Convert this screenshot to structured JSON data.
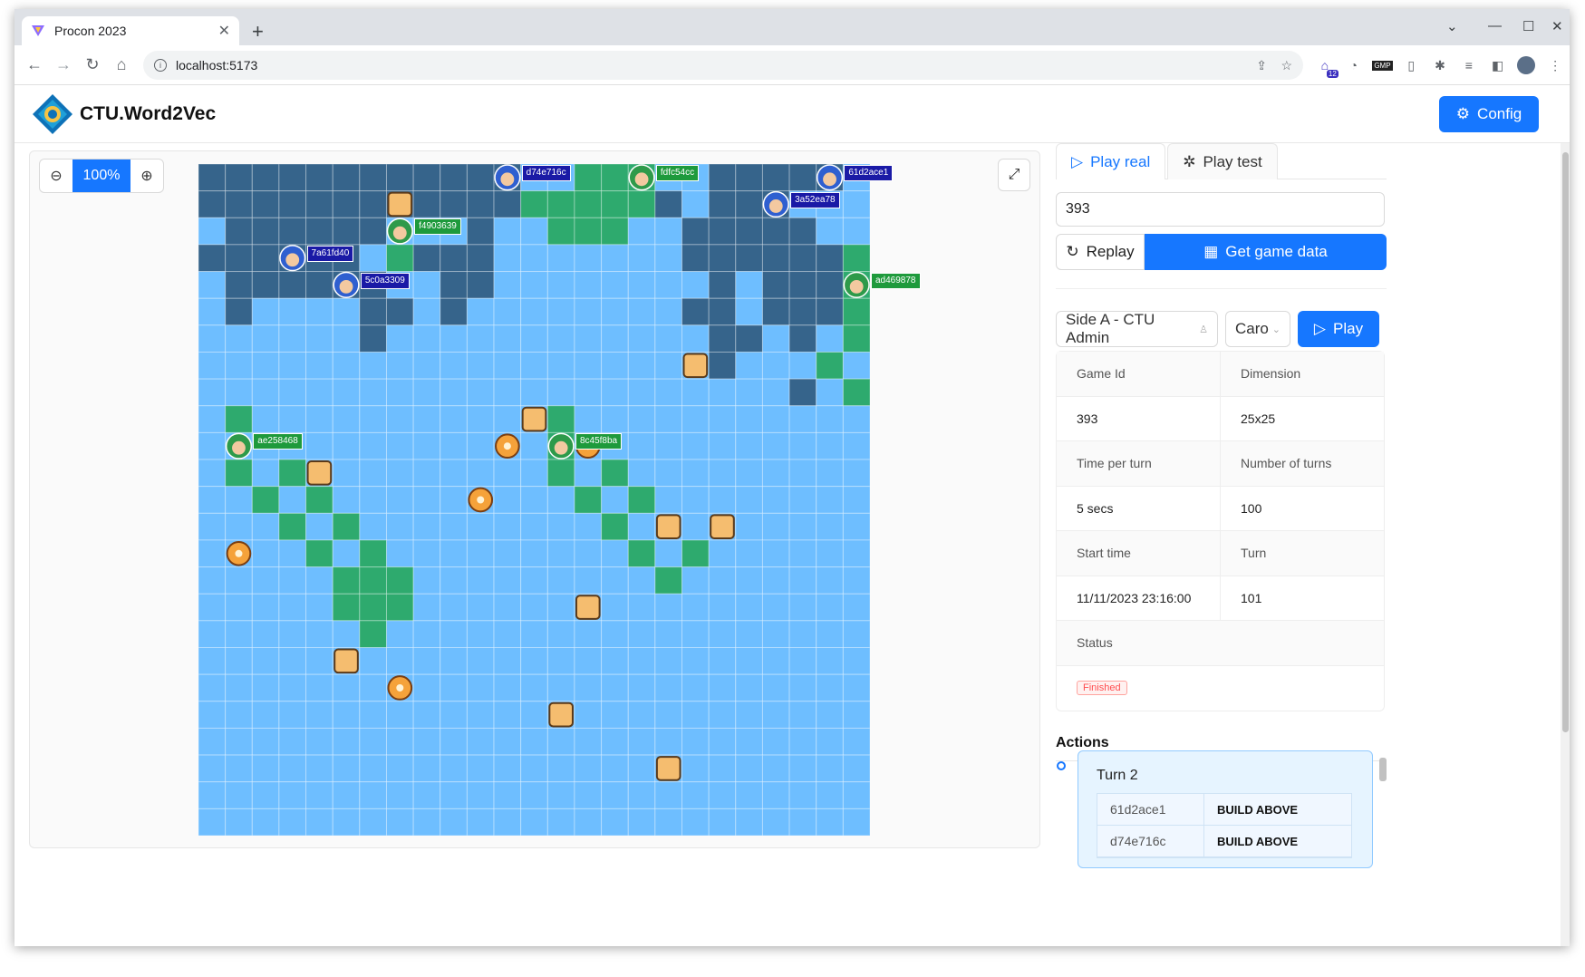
{
  "browser": {
    "tab_title": "Procon 2023",
    "url": "localhost:5173",
    "ext_badge": "12",
    "ext_label": "GMP"
  },
  "header": {
    "brand": "CTU.Word2Vec",
    "config_label": "Config"
  },
  "board_controls": {
    "zoom_value": "100%"
  },
  "board": {
    "size": 25,
    "colors": {
      "water": "#6ebeff",
      "wall_a": "#36648b",
      "wall_b": "#2eaa6e",
      "castle": "#f5bd6f"
    },
    "wall_a": [
      [
        0,
        0
      ],
      [
        0,
        1
      ],
      [
        0,
        2
      ],
      [
        0,
        3
      ],
      [
        0,
        4
      ],
      [
        0,
        5
      ],
      [
        0,
        6
      ],
      [
        0,
        7
      ],
      [
        0,
        8
      ],
      [
        0,
        9
      ],
      [
        0,
        10
      ],
      [
        0,
        11
      ],
      [
        0,
        19
      ],
      [
        0,
        20
      ],
      [
        0,
        21
      ],
      [
        0,
        22
      ],
      [
        0,
        23
      ],
      [
        1,
        0
      ],
      [
        1,
        1
      ],
      [
        1,
        2
      ],
      [
        1,
        3
      ],
      [
        1,
        4
      ],
      [
        1,
        5
      ],
      [
        1,
        6
      ],
      [
        1,
        7
      ],
      [
        1,
        8
      ],
      [
        1,
        9
      ],
      [
        1,
        10
      ],
      [
        1,
        11
      ],
      [
        1,
        17
      ],
      [
        1,
        19
      ],
      [
        1,
        20
      ],
      [
        1,
        21
      ],
      [
        2,
        1
      ],
      [
        2,
        2
      ],
      [
        2,
        3
      ],
      [
        2,
        4
      ],
      [
        2,
        5
      ],
      [
        2,
        6
      ],
      [
        2,
        10
      ],
      [
        2,
        18
      ],
      [
        2,
        19
      ],
      [
        2,
        20
      ],
      [
        2,
        21
      ],
      [
        2,
        22
      ],
      [
        3,
        0
      ],
      [
        3,
        1
      ],
      [
        3,
        2
      ],
      [
        3,
        3
      ],
      [
        3,
        4
      ],
      [
        3,
        5
      ],
      [
        3,
        8
      ],
      [
        3,
        9
      ],
      [
        3,
        10
      ],
      [
        3,
        18
      ],
      [
        3,
        19
      ],
      [
        3,
        20
      ],
      [
        3,
        21
      ],
      [
        3,
        22
      ],
      [
        3,
        23
      ],
      [
        4,
        1
      ],
      [
        4,
        2
      ],
      [
        4,
        3
      ],
      [
        4,
        4
      ],
      [
        4,
        5
      ],
      [
        4,
        6
      ],
      [
        4,
        9
      ],
      [
        4,
        10
      ],
      [
        4,
        19
      ],
      [
        4,
        21
      ],
      [
        4,
        22
      ],
      [
        4,
        23
      ],
      [
        5,
        1
      ],
      [
        5,
        6
      ],
      [
        5,
        7
      ],
      [
        5,
        9
      ],
      [
        5,
        18
      ],
      [
        5,
        19
      ],
      [
        5,
        21
      ],
      [
        5,
        22
      ],
      [
        5,
        23
      ],
      [
        6,
        6
      ],
      [
        6,
        19
      ],
      [
        6,
        20
      ],
      [
        6,
        22
      ],
      [
        7,
        19
      ],
      [
        8,
        22
      ]
    ],
    "wall_b": [
      [
        0,
        14
      ],
      [
        0,
        15
      ],
      [
        0,
        16
      ],
      [
        1,
        12
      ],
      [
        1,
        13
      ],
      [
        1,
        14
      ],
      [
        1,
        15
      ],
      [
        1,
        16
      ],
      [
        2,
        6
      ],
      [
        2,
        13
      ],
      [
        2,
        14
      ],
      [
        2,
        15
      ],
      [
        3,
        7
      ],
      [
        3,
        24
      ],
      [
        4,
        24
      ],
      [
        5,
        24
      ],
      [
        6,
        24
      ],
      [
        7,
        23
      ],
      [
        8,
        24
      ],
      [
        9,
        1
      ],
      [
        9,
        13
      ],
      [
        10,
        13
      ],
      [
        11,
        1
      ],
      [
        11,
        3
      ],
      [
        11,
        13
      ],
      [
        11,
        15
      ],
      [
        12,
        2
      ],
      [
        12,
        4
      ],
      [
        12,
        14
      ],
      [
        12,
        16
      ],
      [
        13,
        3
      ],
      [
        13,
        5
      ],
      [
        13,
        15
      ],
      [
        14,
        4
      ],
      [
        14,
        6
      ],
      [
        14,
        16
      ],
      [
        14,
        18
      ],
      [
        15,
        5
      ],
      [
        15,
        6
      ],
      [
        15,
        7
      ],
      [
        15,
        17
      ],
      [
        16,
        5
      ],
      [
        16,
        6
      ],
      [
        16,
        7
      ],
      [
        17,
        6
      ]
    ],
    "castles": [
      [
        1,
        7
      ],
      [
        7,
        18
      ],
      [
        9,
        12
      ],
      [
        11,
        4
      ],
      [
        13,
        17
      ],
      [
        13,
        19
      ],
      [
        16,
        14
      ],
      [
        18,
        5
      ],
      [
        20,
        13
      ],
      [
        22,
        17
      ]
    ],
    "agents_a": [
      {
        "id": "d74e716c",
        "r": 0,
        "c": 11
      },
      {
        "id": "61d2ace1",
        "r": 0,
        "c": 23
      },
      {
        "id": "3a52ea78",
        "r": 1,
        "c": 21
      },
      {
        "id": "7a61fd40",
        "r": 3,
        "c": 3
      },
      {
        "id": "5c0a3309",
        "r": 4,
        "c": 5
      }
    ],
    "agents_b": [
      {
        "id": "fdfc54cc",
        "r": 0,
        "c": 16
      },
      {
        "id": "f4903639",
        "r": 2,
        "c": 7
      },
      {
        "id": "ad469878",
        "r": 4,
        "c": 24
      },
      {
        "id": "ae258468",
        "r": 10,
        "c": 1
      },
      {
        "id": "8c45f8ba",
        "r": 10,
        "c": 13
      }
    ],
    "ponds": [
      [
        10,
        11
      ],
      [
        12,
        10
      ],
      [
        14,
        1
      ],
      [
        19,
        7
      ],
      [
        10,
        14
      ]
    ]
  },
  "side": {
    "tab_real": "Play real",
    "tab_test": "Play test",
    "game_id_input": "393",
    "replay_label": "Replay",
    "get_data_label": "Get game data",
    "side_select": "Side A - CTU Admin",
    "algo_select": "Caro",
    "play_label": "Play",
    "info": {
      "game_id_label": "Game Id",
      "dimension_label": "Dimension",
      "game_id": "393",
      "dimension": "25x25",
      "time_label": "Time per turn",
      "turns_label": "Number of turns",
      "time": "5 secs",
      "turns": "100",
      "start_label": "Start time",
      "turn_label": "Turn",
      "start": "11/11/2023 23:16:00",
      "turn": "101",
      "status_label": "Status",
      "status": "Finished"
    },
    "actions_title": "Actions",
    "turn_card": {
      "title": "Turn 2",
      "rows": [
        {
          "agent": "61d2ace1",
          "action": "BUILD ABOVE"
        },
        {
          "agent": "d74e716c",
          "action": "BUILD ABOVE"
        }
      ]
    }
  }
}
